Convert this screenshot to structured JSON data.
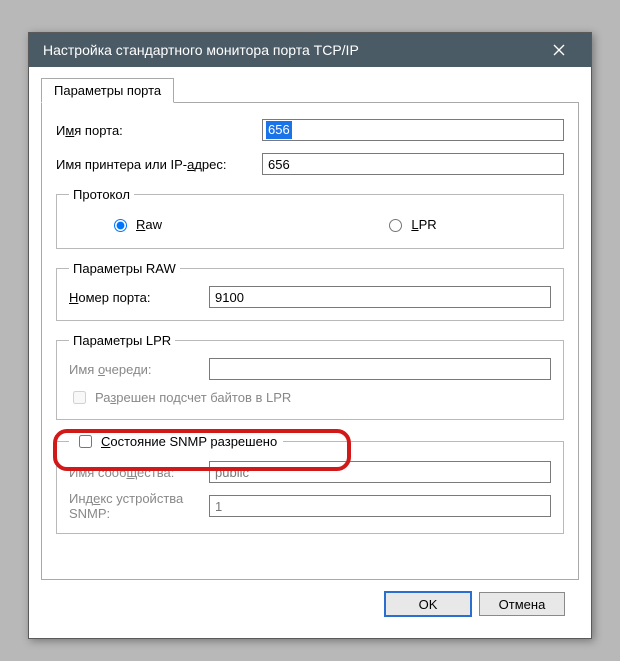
{
  "window": {
    "title": "Настройка стандартного монитора порта TCP/IP"
  },
  "tabs": {
    "port_params": "Параметры порта"
  },
  "fields": {
    "port_name_label_pre": "И",
    "port_name_label_u": "м",
    "port_name_label_post": "я порта:",
    "port_name_value": "656",
    "printer_label_pre": "Имя принтера или IP-",
    "printer_label_u": "а",
    "printer_label_post": "дрес:",
    "printer_value": "656"
  },
  "protocol": {
    "legend": "Протокол",
    "raw_u": "R",
    "raw_post": "aw",
    "lpr_u": "L",
    "lpr_post": "PR"
  },
  "raw": {
    "legend": "Параметры RAW",
    "port_num_u": "Н",
    "port_num_post": "омер порта:",
    "port_num_value": "9100"
  },
  "lpr": {
    "legend": "Параметры LPR",
    "queue_pre": "Имя ",
    "queue_u": "о",
    "queue_post": "череди:",
    "queue_value": "",
    "bytes_pre": "Ра",
    "bytes_u": "з",
    "bytes_post": "решен подсчет байтов в LPR"
  },
  "snmp": {
    "legend_pre": "",
    "legend_u": "С",
    "legend_post": "остояние SNMP разрешено",
    "community_pre": "Имя сооб",
    "community_u": "щ",
    "community_post": "ества:",
    "community_value": "public",
    "index_pre": "Инд",
    "index_u": "е",
    "index_post": "кс устройства SNMP:",
    "index_value": "1"
  },
  "buttons": {
    "ok": "OK",
    "cancel": "Отмена"
  }
}
